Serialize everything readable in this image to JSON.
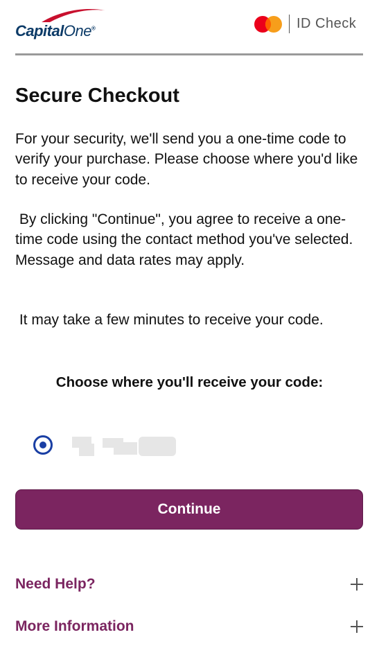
{
  "header": {
    "logo_text_capital": "Capital",
    "logo_text_one": "One",
    "logo_mark": "®",
    "idcheck_label": "ID Check",
    "icons": [
      "capital-one-logo",
      "mastercard-icon"
    ]
  },
  "main": {
    "title": "Secure Checkout",
    "paragraph_1": "For your security, we'll send you a one-time code to verify your purchase. Please choose where you'd like to receive your code.",
    "paragraph_2": " By clicking \"Continue\", you agree to receive a one-time code using the contact method you've selected. Message and data rates may apply.",
    "paragraph_3": " It may take a few minutes to receive your code.",
    "choose_label": "Choose where you'll receive your code:",
    "contact_option": {
      "selected": true,
      "value_obscured": true
    },
    "continue_label": "Continue"
  },
  "footer": {
    "accordions": [
      {
        "label": "Need Help?"
      },
      {
        "label": "More Information"
      }
    ]
  },
  "colors": {
    "brand_burgundy": "#7b2560",
    "radio_blue": "#1a3fa4",
    "capital_one_navy": "#0b3a67",
    "capital_one_red": "#c8102e",
    "mastercard_red": "#eb001b",
    "mastercard_orange": "#f79e1b",
    "divider_gray": "#9a9a9a"
  }
}
